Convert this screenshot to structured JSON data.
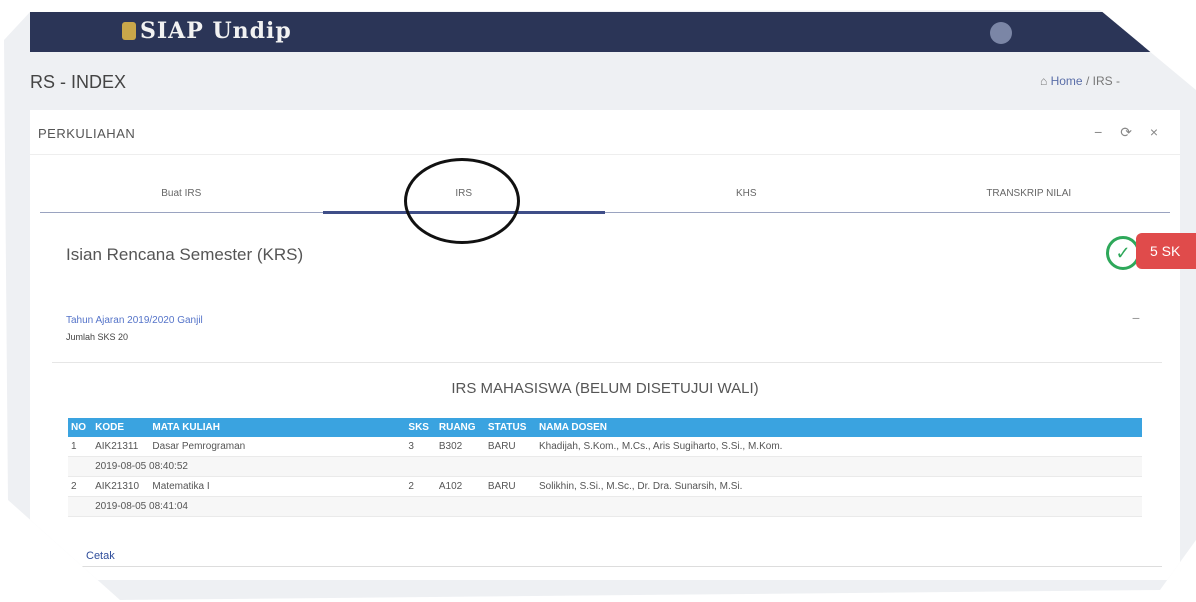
{
  "app": {
    "title": "SIAP Undip"
  },
  "page": {
    "title": "RS - INDEX"
  },
  "breadcrumb": {
    "home": "Home",
    "separator": "/",
    "current": "IRS -"
  },
  "card": {
    "title": "PERKULIAHAN",
    "tools": {
      "minimize": "−",
      "refresh": "⟳",
      "close": "×"
    }
  },
  "tabs": [
    {
      "label": "Buat IRS",
      "active": false
    },
    {
      "label": "IRS",
      "active": true
    },
    {
      "label": "KHS",
      "active": false
    },
    {
      "label": "TRANSKRIP NILAI",
      "active": false
    }
  ],
  "section": {
    "title": "Isian Rencana Semester (KRS)",
    "badge": "5 SK"
  },
  "term": {
    "link": "Tahun Ajaran 2019/2020 Ganjil",
    "total": "Jumlah SKS 20",
    "collapse": "−"
  },
  "irs": {
    "title": "IRS MAHASISWA (BELUM DISETUJUI WALI)",
    "headers": [
      "NO",
      "KODE",
      "MATA KULIAH",
      "SKS",
      "RUANG",
      "STATUS",
      "NAMA DOSEN"
    ],
    "rows": [
      {
        "no": "1",
        "kode": "AIK21311",
        "mk": "Dasar Pemrograman",
        "sks": "3",
        "ruang": "B302",
        "status": "BARU",
        "dosen": "Khadijah, S.Kom., M.Cs., Aris Sugiharto, S.Si., M.Kom.",
        "timestamp": "2019-08-05 08:40:52"
      },
      {
        "no": "2",
        "kode": "AIK21310",
        "mk": "Matematika I",
        "sks": "2",
        "ruang": "A102",
        "status": "BARU",
        "dosen": "Solikhin, S.Si., M.Sc., Dr. Dra. Sunarsih, M.Si.",
        "timestamp": "2019-08-05 08:41:04"
      }
    ],
    "print_label": "Cetak"
  },
  "colors": {
    "navbar": "#2b3557",
    "table_header": "#3aa3e0",
    "badge": "#e04b4b",
    "check": "#2ea85a"
  }
}
